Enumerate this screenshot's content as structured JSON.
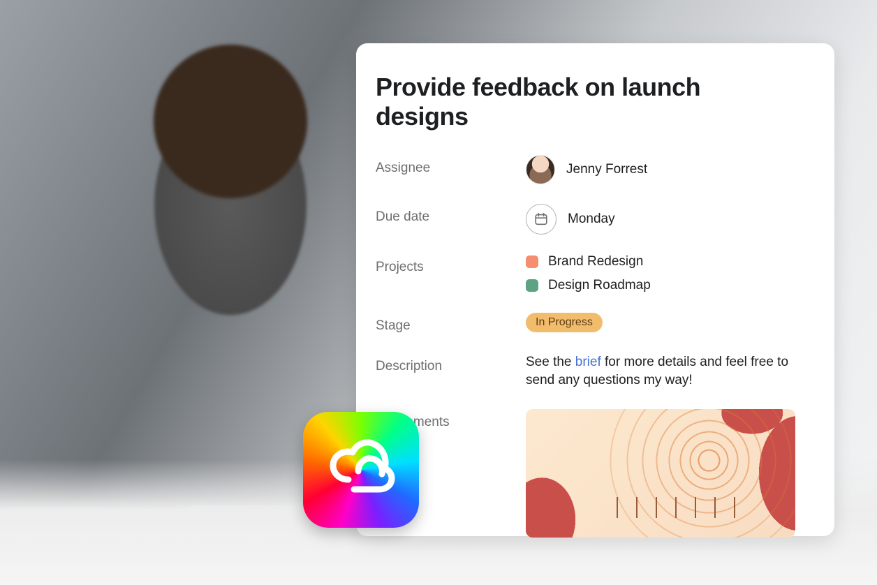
{
  "task": {
    "title": "Provide feedback on launch designs",
    "fields": {
      "assignee_label": "Assignee",
      "assignee_name": "Jenny Forrest",
      "due_date_label": "Due date",
      "due_date_value": "Monday",
      "projects_label": "Projects",
      "projects": [
        {
          "name": "Brand Redesign",
          "color": "#f58e6f"
        },
        {
          "name": "Design Roadmap",
          "color": "#5da283"
        }
      ],
      "stage_label": "Stage",
      "stage_value": "In Progress",
      "stage_color": "#f1bd6c",
      "description_label": "Description",
      "description_pre": "See the ",
      "description_link": "brief",
      "description_post": " for more details and feel free to send any questions my way!",
      "attachments_label": "Attachments"
    }
  },
  "overlay_logo": {
    "name": "creative-cloud"
  }
}
